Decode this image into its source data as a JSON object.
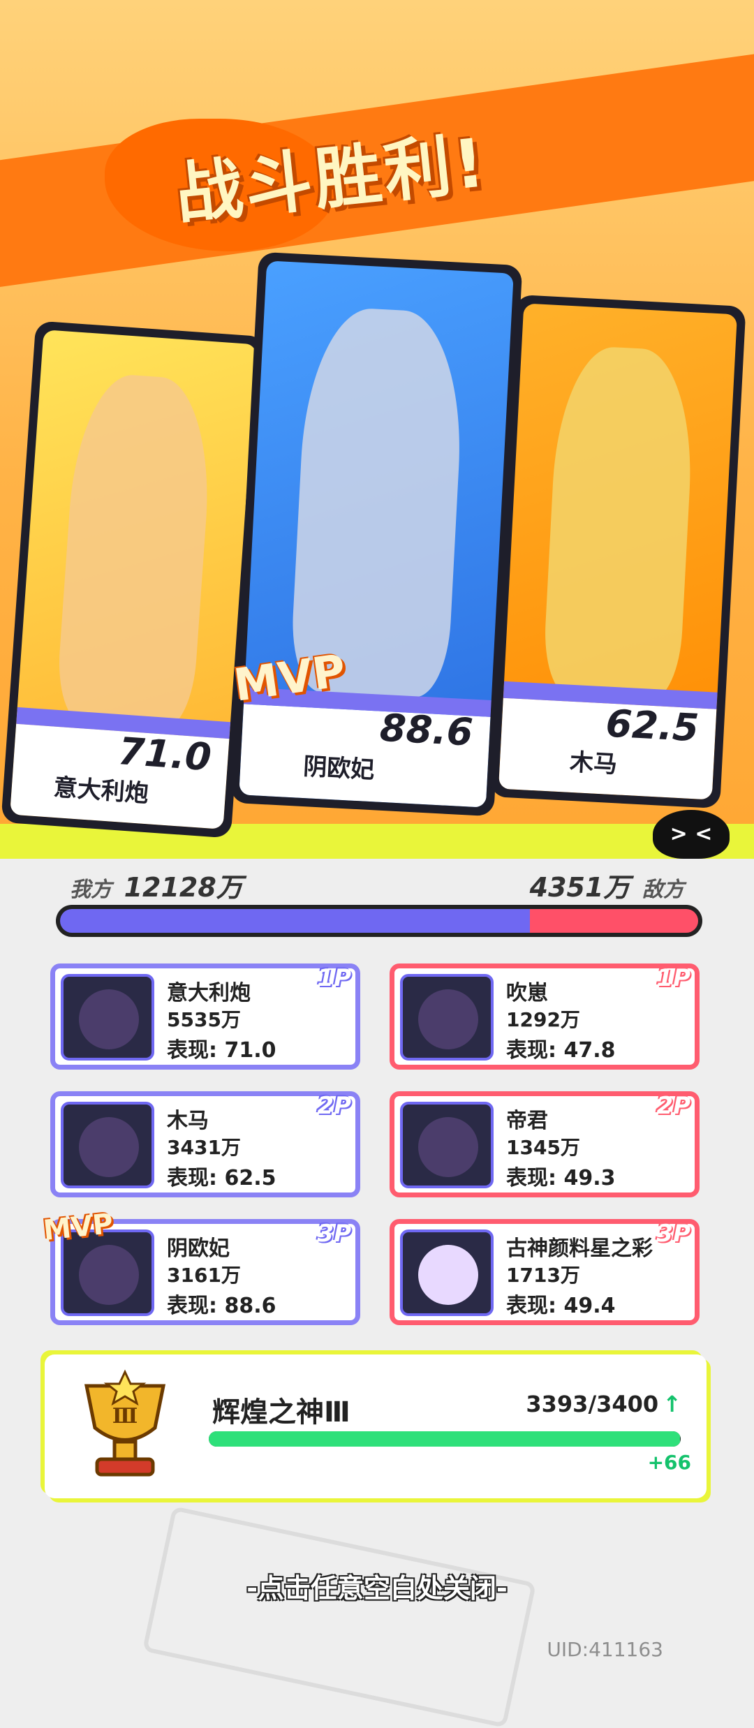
{
  "header": {
    "title": "战斗胜利!"
  },
  "podium": [
    {
      "name": "意大利炮",
      "score": "71.0"
    },
    {
      "name": "阴欧妃",
      "score": "88.6",
      "mvp_label": "MVP"
    },
    {
      "name": "木马",
      "score": "62.5"
    }
  ],
  "summary": {
    "ally_label": "我方",
    "ally_total": "12128万",
    "enemy_label": "敌方",
    "enemy_total": "4351万",
    "ally_share": 0.736
  },
  "allies": [
    {
      "rank": "1P",
      "name": "意大利炮",
      "value": "5535万",
      "perf": "表现: 71.0"
    },
    {
      "rank": "2P",
      "name": "木马",
      "value": "3431万",
      "perf": "表现: 62.5"
    },
    {
      "rank": "3P",
      "name": "阴欧妃",
      "value": "3161万",
      "perf": "表现: 88.6",
      "mvp_label": "MVP"
    }
  ],
  "enemies": [
    {
      "rank": "1P",
      "name": "吹崽",
      "value": "1292万",
      "perf": "表现: 47.8"
    },
    {
      "rank": "2P",
      "name": "帝君",
      "value": "1345万",
      "perf": "表现: 49.3"
    },
    {
      "rank": "3P",
      "name": "古神颜料星之彩",
      "value": "1713万",
      "perf": "表现: 49.4"
    }
  ],
  "rank": {
    "name": "辉煌之神Ⅲ",
    "progress_text": "3393/3400",
    "progress_ratio": 0.998,
    "gain": "+66"
  },
  "footer": {
    "close_hint": "-点击任意空白处关闭-",
    "uid": "UID:411163"
  },
  "colors": {
    "ally": "#6f68f2",
    "enemy": "#ff5068",
    "progress": "#2ee07a",
    "accent": "#ff7a12"
  }
}
